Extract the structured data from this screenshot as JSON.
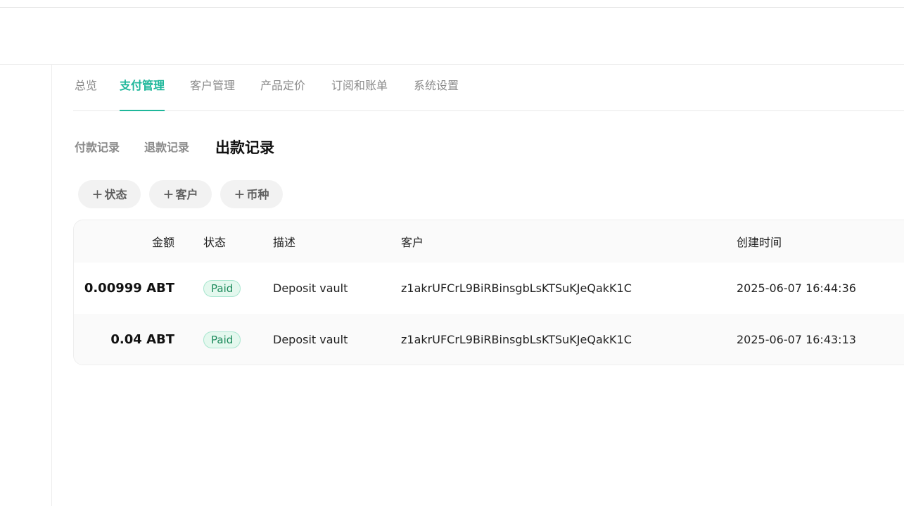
{
  "nav": {
    "tabs": [
      {
        "label": "总览",
        "active": false
      },
      {
        "label": "支付管理",
        "active": true
      },
      {
        "label": "客户管理",
        "active": false
      },
      {
        "label": "产品定价",
        "active": false
      },
      {
        "label": "订阅和账单",
        "active": false
      },
      {
        "label": "系统设置",
        "active": false
      }
    ]
  },
  "subtabs": [
    {
      "label": "付款记录",
      "active": false
    },
    {
      "label": "退款记录",
      "active": false
    },
    {
      "label": "出款记录",
      "active": true
    }
  ],
  "filters": [
    {
      "label": "状态",
      "icon": "plus-icon"
    },
    {
      "label": "客户",
      "icon": "plus-icon"
    },
    {
      "label": "币种",
      "icon": "plus-icon"
    }
  ],
  "table": {
    "columns": [
      "金额",
      "状态",
      "描述",
      "客户",
      "创建时间"
    ],
    "rows": [
      {
        "amount": "0.00999 ABT",
        "status": "Paid",
        "description": "Deposit vault",
        "customer": "z1akrUFCrL9BiRBinsgbLsKTSuKJeQakK1C",
        "created": "2025-06-07 16:44:36"
      },
      {
        "amount": "0.04 ABT",
        "status": "Paid",
        "description": "Deposit vault",
        "customer": "z1akrUFCrL9BiRBinsgbLsKTSuKJeQakK1C",
        "created": "2025-06-07 16:43:13"
      }
    ]
  },
  "colors": {
    "accent": "#1eb79a",
    "badge_bg": "#e4f8ee",
    "badge_text": "#1d8a5c"
  }
}
